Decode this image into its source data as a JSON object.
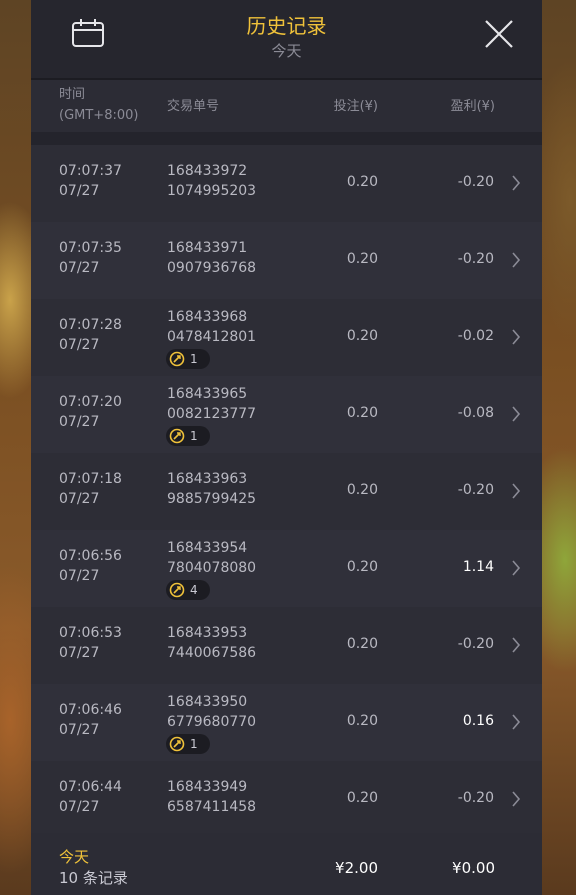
{
  "header": {
    "title": "历史记录",
    "subtitle": "今天",
    "calendar_icon": "calendar-icon",
    "close_icon": "close-icon"
  },
  "columns": {
    "time_line1": "时间",
    "time_line2": "(GMT+8:00)",
    "order": "交易单号",
    "bet": "投注(¥)",
    "profit": "盈利(¥)"
  },
  "rows": [
    {
      "time": "07:07:37",
      "date": "07/27",
      "order1": "168433972",
      "order2": "1074995203",
      "bet": "0.20",
      "profit": "-0.20",
      "positive": false,
      "badge": null
    },
    {
      "time": "07:07:35",
      "date": "07/27",
      "order1": "168433971",
      "order2": "0907936768",
      "bet": "0.20",
      "profit": "-0.20",
      "positive": false,
      "badge": null
    },
    {
      "time": "07:07:28",
      "date": "07/27",
      "order1": "168433968",
      "order2": "0478412801",
      "bet": "0.20",
      "profit": "-0.02",
      "positive": false,
      "badge": "1"
    },
    {
      "time": "07:07:20",
      "date": "07/27",
      "order1": "168433965",
      "order2": "0082123777",
      "bet": "0.20",
      "profit": "-0.08",
      "positive": false,
      "badge": "1"
    },
    {
      "time": "07:07:18",
      "date": "07/27",
      "order1": "168433963",
      "order2": "9885799425",
      "bet": "0.20",
      "profit": "-0.20",
      "positive": false,
      "badge": null
    },
    {
      "time": "07:06:56",
      "date": "07/27",
      "order1": "168433954",
      "order2": "7804078080",
      "bet": "0.20",
      "profit": "1.14",
      "positive": true,
      "badge": "4"
    },
    {
      "time": "07:06:53",
      "date": "07/27",
      "order1": "168433953",
      "order2": "7440067586",
      "bet": "0.20",
      "profit": "-0.20",
      "positive": false,
      "badge": null
    },
    {
      "time": "07:06:46",
      "date": "07/27",
      "order1": "168433950",
      "order2": "6779680770",
      "bet": "0.20",
      "profit": "0.16",
      "positive": true,
      "badge": "1"
    },
    {
      "time": "07:06:44",
      "date": "07/27",
      "order1": "168433949",
      "order2": "6587411458",
      "bet": "0.20",
      "profit": "-0.20",
      "positive": false,
      "badge": null
    }
  ],
  "footer": {
    "label": "今天",
    "count": "10 条记录",
    "total_bet": "¥2.00",
    "total_profit": "¥0.00"
  },
  "colors": {
    "accent": "#f0c23a",
    "panel": "#24242c",
    "row_odd": "#2d2d36",
    "row_even": "#30303a"
  }
}
